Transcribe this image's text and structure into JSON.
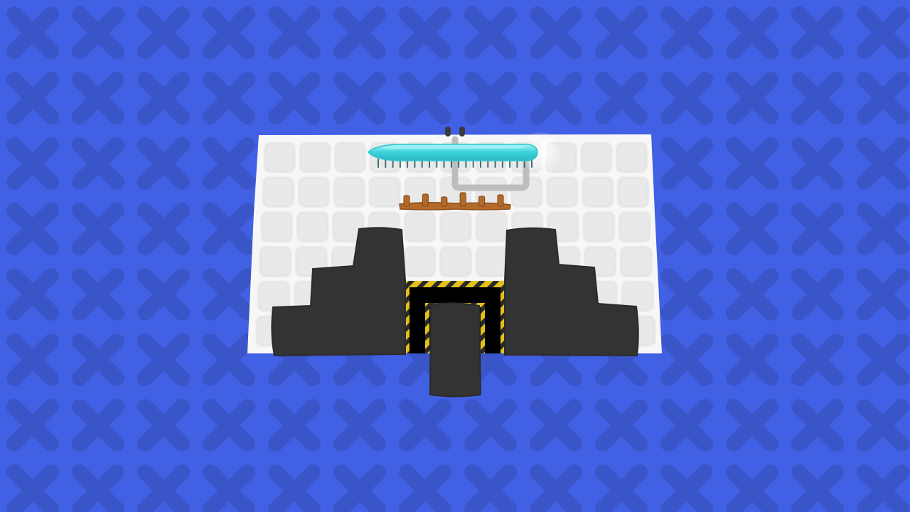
{
  "colors": {
    "background": "#4160E4",
    "background_pattern": "#3A55C8",
    "board_surface": "#F7F7F7",
    "board_tile": "#E9E9E9",
    "board_tile_edge": "#DADADA",
    "wall_block": "#333333",
    "hazard_stripe_yellow": "#E2C019",
    "hazard_stripe_dark": "#2A2A2A",
    "pit_interior": "#000000",
    "rail": "#BDBDBD",
    "ice_saw_blade": "#3ED4DC",
    "ice_saw_highlight": "#A9F3F6",
    "ice_saw_teeth": "#3D6F72",
    "wooden_spikes": "#B36B2C",
    "wooden_spikes_dark": "#8A4E1C",
    "post_knob": "#3A3A3A"
  },
  "scene": {
    "board_grid": {
      "rows": 6,
      "cols": 11
    },
    "saw_blade_teeth_count": 22,
    "wooden_spike_count": 6
  }
}
